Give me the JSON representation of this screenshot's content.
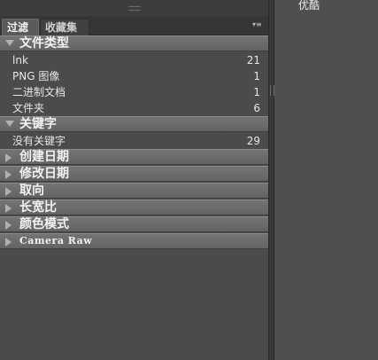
{
  "panel": {
    "tabs": [
      {
        "label": "过滤",
        "active": true
      },
      {
        "label": "收藏集",
        "active": false
      }
    ],
    "menu_icon": "≡"
  },
  "sections": [
    {
      "label": "文件类型",
      "expanded": true,
      "rows": [
        {
          "name": "lnk",
          "count": "21"
        },
        {
          "name": "PNG 图像",
          "count": "1"
        },
        {
          "name": "二进制文档",
          "count": "1"
        },
        {
          "name": "文件夹",
          "count": "6"
        }
      ]
    },
    {
      "label": "关键字",
      "expanded": true,
      "rows": [
        {
          "name": "没有关键字",
          "count": "29"
        }
      ]
    },
    {
      "label": "创建日期",
      "expanded": false
    },
    {
      "label": "修改日期",
      "expanded": false
    },
    {
      "label": "取向",
      "expanded": false
    },
    {
      "label": "长宽比",
      "expanded": false
    },
    {
      "label": "颜色模式",
      "expanded": false
    },
    {
      "label": "Camera Raw",
      "expanded": false
    }
  ],
  "content": {
    "label": "优酷"
  },
  "colors": {
    "background": "#4d4d4d",
    "section_header": "#6b6b6b",
    "tab_bar": "#363636",
    "text": "#e6e6e6"
  }
}
